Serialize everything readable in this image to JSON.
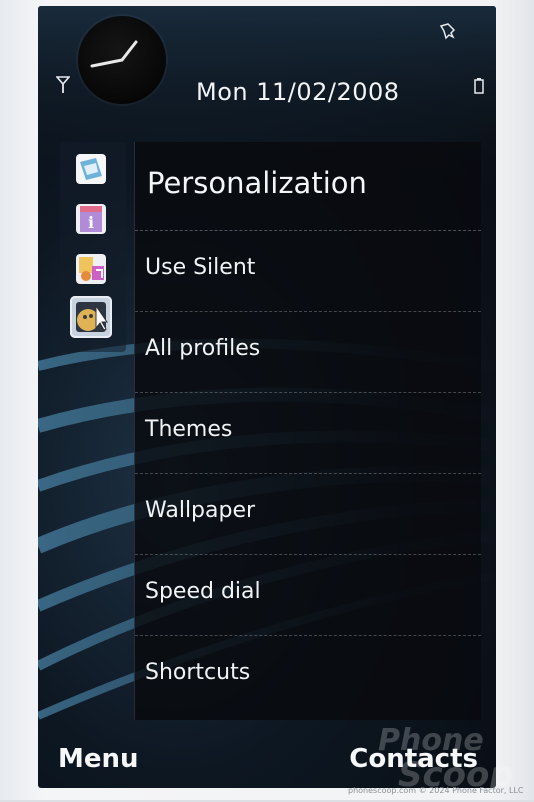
{
  "status": {
    "date": "Mon 11/02/2008",
    "icons": [
      "signal-icon",
      "pin-icon",
      "battery-icon",
      "analog-clock-icon"
    ]
  },
  "apps": [
    {
      "name": "gallery-app-icon"
    },
    {
      "name": "info-app-icon"
    },
    {
      "name": "music-app-icon"
    },
    {
      "name": "personalization-app-icon",
      "selected": true
    }
  ],
  "panel": {
    "title": "Personalization",
    "items": [
      {
        "label": "Use Silent"
      },
      {
        "label": "All profiles"
      },
      {
        "label": "Themes"
      },
      {
        "label": "Wallpaper"
      },
      {
        "label": "Speed dial"
      },
      {
        "label": "Shortcuts"
      }
    ]
  },
  "softkeys": {
    "left": "Menu",
    "right": "Contacts"
  },
  "watermark": {
    "line1": "Phone",
    "line2": "Scoop"
  },
  "credit": "phonescoop.com © 2024 Phone Factor, LLC",
  "colors": {
    "screen_bg": "#070b10",
    "accent_swoosh": "#4a90b8",
    "text": "#f2f4f6",
    "selected_slot": "#c8d3e0"
  }
}
